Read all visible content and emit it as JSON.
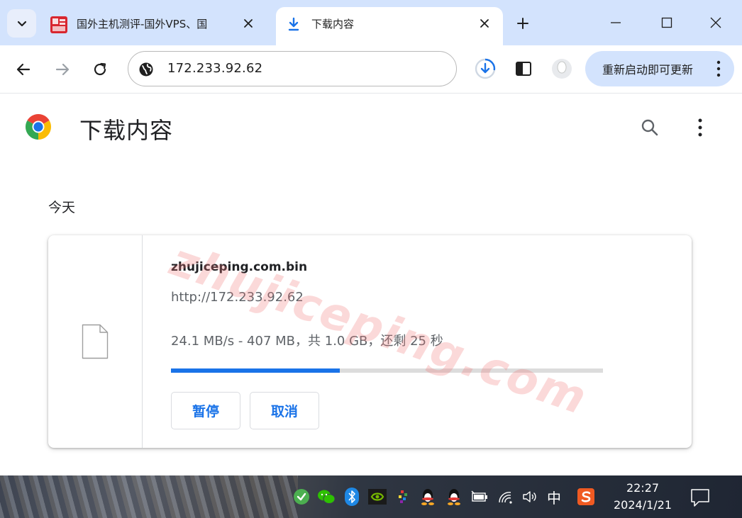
{
  "browser": {
    "tabs": [
      {
        "title": "国外主机测评-国外VPS、国",
        "active": false,
        "favicon": "zhujiceping-favicon"
      },
      {
        "title": "下载内容",
        "active": true,
        "favicon": "download-icon"
      }
    ],
    "address": {
      "url": "172.233.92.62"
    },
    "update_button": {
      "label": "重新启动即可更新"
    }
  },
  "page": {
    "title": "下载内容",
    "section_date": "今天"
  },
  "download": {
    "filename": "zhujiceping.com.bin",
    "source_url": "http://172.233.92.62",
    "status": "24.1 MB/s - 407 MB，共 1.0 GB，还剩 25 秒",
    "progress_fraction": 0.39,
    "pause_label": "暂停",
    "cancel_label": "取消"
  },
  "watermark": {
    "text": "zhujiceping.com"
  },
  "taskbar": {
    "ime": "中",
    "time": "22:27",
    "date": "2024/1/21"
  },
  "colors": {
    "accent": "#1a73e8",
    "tabstrip": "#d3e3fd",
    "progress_track": "#dcdcdc"
  }
}
